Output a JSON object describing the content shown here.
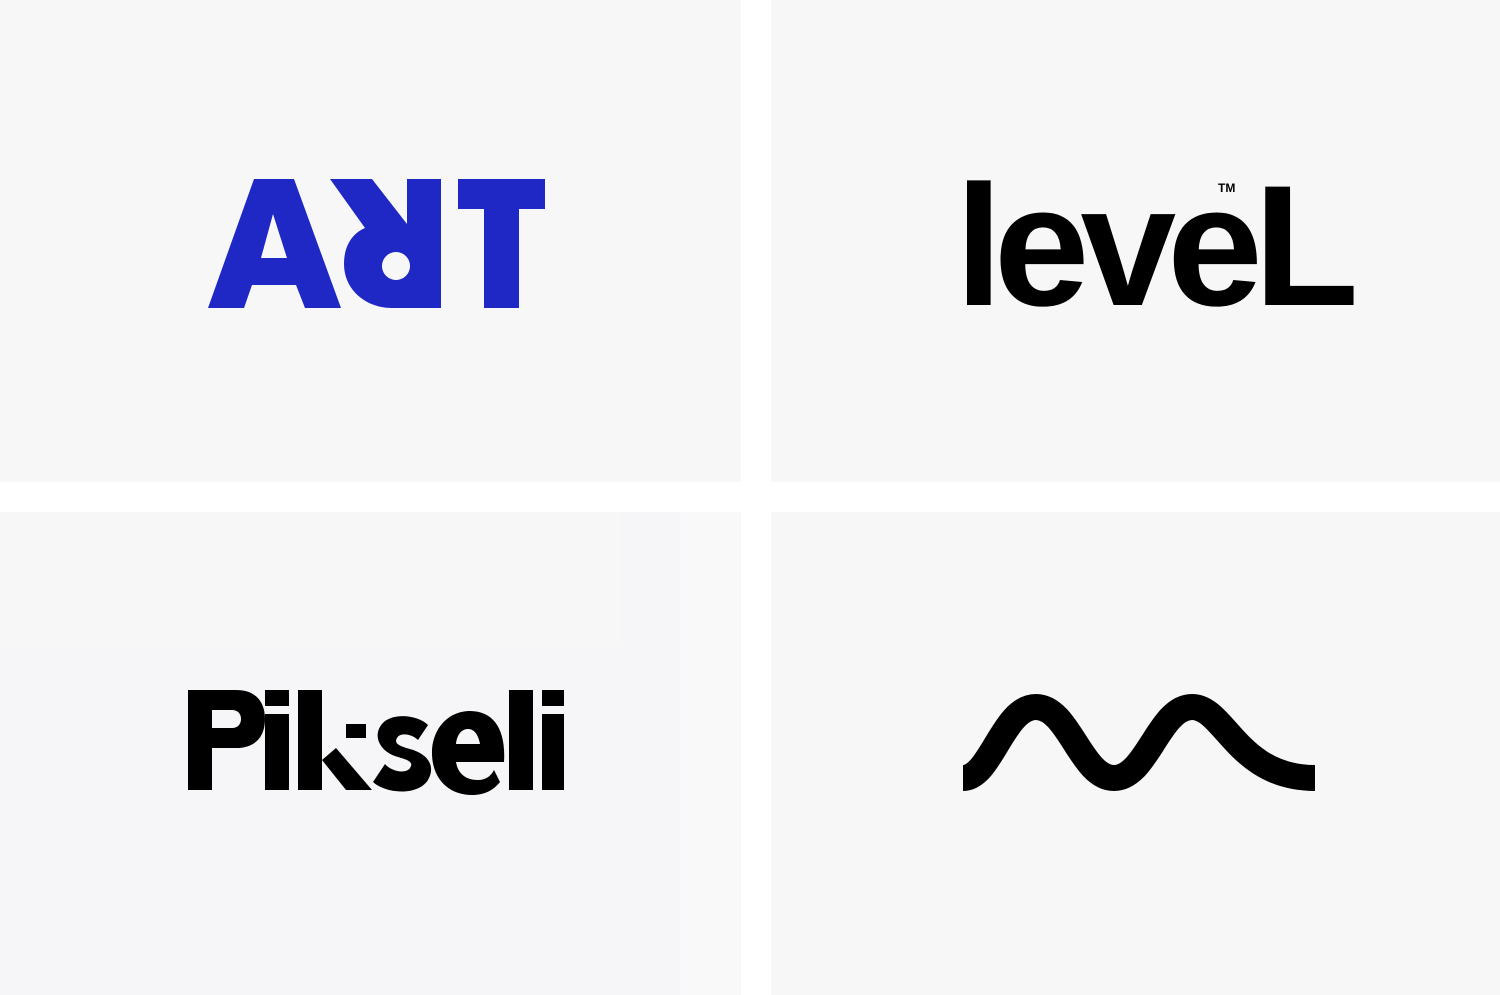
{
  "panels": [
    {
      "name": "art-logo",
      "wordmark": "ART",
      "color": "#1f27c4"
    },
    {
      "name": "level-logo",
      "wordmark": "leveL",
      "trademark": "TM",
      "color": "#000000"
    },
    {
      "name": "pikseli-logo",
      "wordmark": "Pikseli",
      "color": "#000000"
    },
    {
      "name": "wave-logo",
      "icon": "wave-m-icon",
      "color": "#000000"
    }
  ],
  "colors": {
    "panel_background": "#f7f7f8",
    "gutter": "#ffffff",
    "art_blue": "#1f27c4",
    "ink": "#000000"
  }
}
